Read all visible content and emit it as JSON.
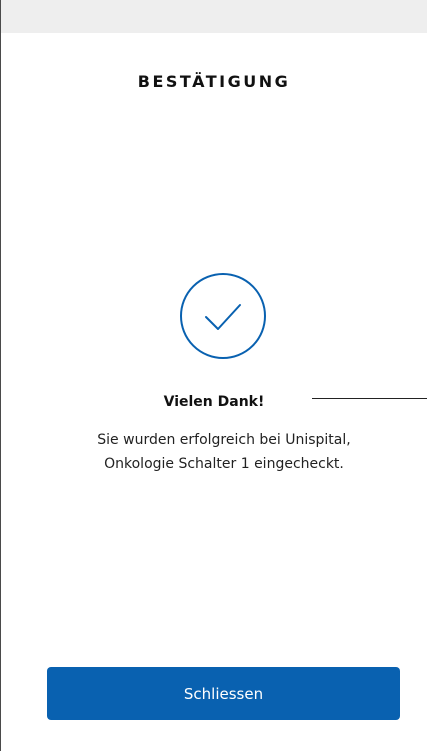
{
  "header": {
    "title": "BESTÄTIGUNG"
  },
  "confirmation": {
    "icon": "checkmark-circle-icon",
    "heading": "Vielen Dank!",
    "message_line1": "Sie wurden erfolgreich bei Unispital,",
    "message_line2": "Onkologie Schalter 1 eingecheckt."
  },
  "actions": {
    "close_label": "Schliessen"
  },
  "colors": {
    "accent": "#0961b0",
    "topbar": "#eeeeee"
  }
}
